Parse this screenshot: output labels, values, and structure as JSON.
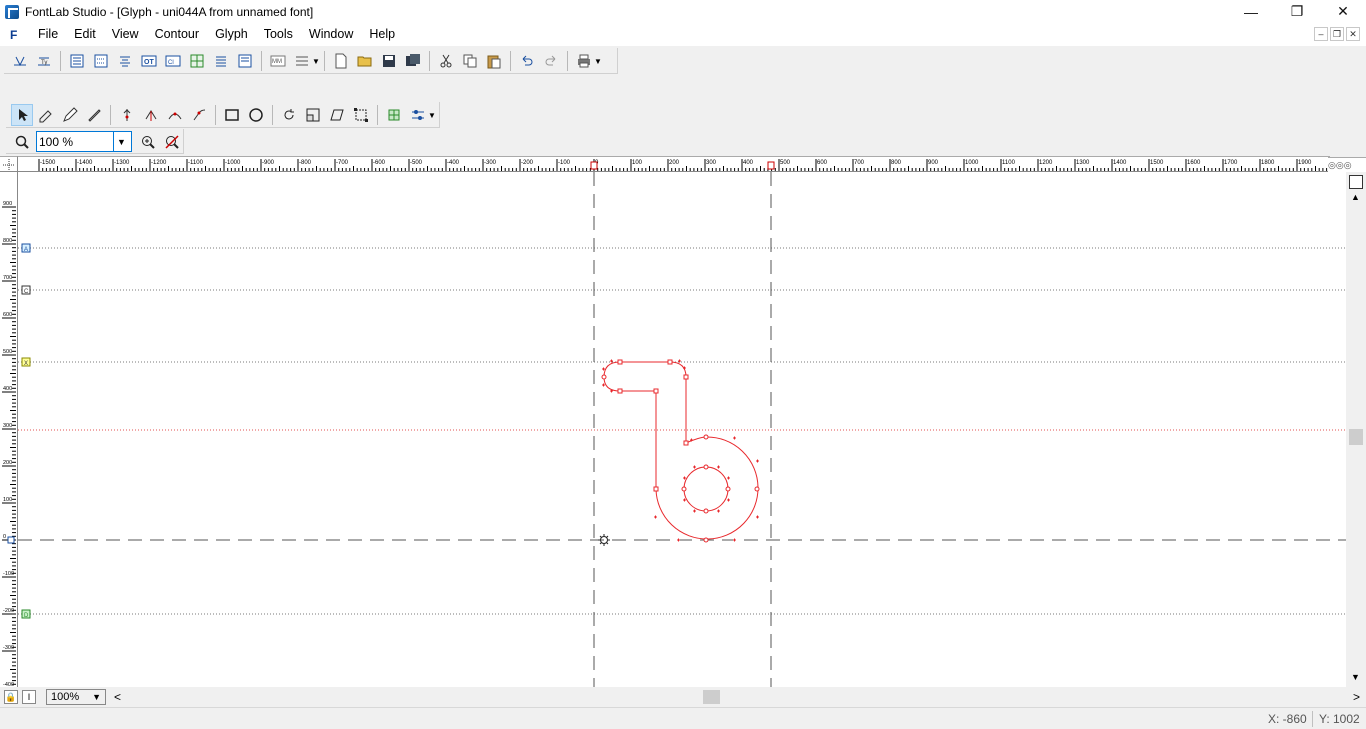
{
  "window": {
    "title": "FontLab Studio - [Glyph - uni044A from unnamed font]",
    "minimize": "—",
    "maximize": "❐",
    "close": "✕"
  },
  "menu": {
    "logo": "F",
    "items": [
      "File",
      "Edit",
      "View",
      "Contour",
      "Glyph",
      "Tools",
      "Window",
      "Help"
    ]
  },
  "mdi": {
    "minimize": "–",
    "restore": "❐",
    "close": "✕"
  },
  "zoom": {
    "value": "100 %"
  },
  "bottom": {
    "zoom_value": "100%",
    "left_arrow": "<",
    "right_arrow": ">"
  },
  "status": {
    "x": "X: -860",
    "y": "Y: 1002"
  },
  "rulers": {
    "horizontal": [
      "-1500",
      "-1400",
      "-1300",
      "-1200",
      "-1100",
      "-1000",
      "-900",
      "-800",
      "-700",
      "-600",
      "-500",
      "-400",
      "-300",
      "-200",
      "-100",
      "0",
      "100",
      "200",
      "300",
      "400",
      "500",
      "600",
      "700",
      "800",
      "900",
      "1000",
      "1100",
      "1200",
      "1300",
      "1400",
      "1500",
      "1600",
      "1700",
      "1800",
      "1900"
    ],
    "vertical": [
      "900",
      "800",
      "700",
      "600",
      "500",
      "400",
      "300",
      "200",
      "100",
      "0",
      "-100",
      "-200",
      "-300",
      "-400"
    ]
  },
  "guides": {
    "markers": [
      "A",
      "C",
      "X",
      "D"
    ]
  },
  "colors": {
    "accent": "#0078d7",
    "contour": "#e8282c",
    "guide": "#7a7a7a"
  }
}
